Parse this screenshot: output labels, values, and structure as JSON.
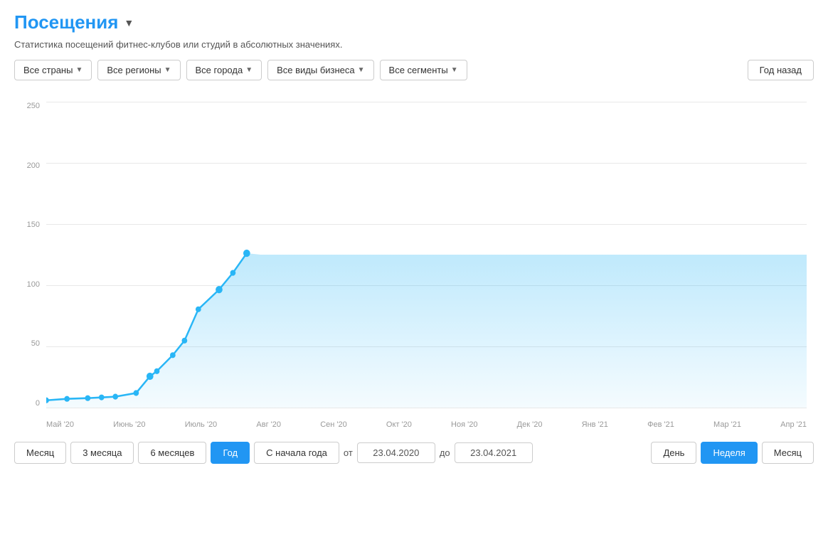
{
  "header": {
    "title": "Посещения",
    "dropdown_arrow": "▼"
  },
  "subtitle": "Статистика посещений фитнес-клубов или студий в абсолютных значениях.",
  "filters": [
    {
      "label": "Все страны",
      "id": "countries"
    },
    {
      "label": "Все регионы",
      "id": "regions"
    },
    {
      "label": "Все города",
      "id": "cities"
    },
    {
      "label": "Все виды бизнеса",
      "id": "business"
    },
    {
      "label": "Все сегменты",
      "id": "segments"
    }
  ],
  "year_back_btn": "Год назад",
  "chart": {
    "y_labels": [
      "250",
      "200",
      "150",
      "100",
      "50",
      "0"
    ],
    "x_labels": [
      "Май '20",
      "Июнь '20",
      "Июль '20",
      "Авг '20",
      "Сен '20",
      "Окт '20",
      "Ноя '20",
      "Дек '20",
      "Янв '21",
      "Фев '21",
      "Мар '21",
      "Апр '21"
    ]
  },
  "bottom_controls": {
    "period_buttons": [
      {
        "label": "Месяц",
        "active": false
      },
      {
        "label": "3 месяца",
        "active": false
      },
      {
        "label": "6 месяцев",
        "active": false
      },
      {
        "label": "Год",
        "active": true
      },
      {
        "label": "С начала года",
        "active": false
      }
    ],
    "from_label": "от",
    "to_label": "до",
    "from_date": "23.04.2020",
    "to_date": "23.04.2021",
    "granularity_buttons": [
      {
        "label": "День",
        "active": false
      },
      {
        "label": "Неделя",
        "active": true
      },
      {
        "label": "Месяц",
        "active": false
      }
    ]
  }
}
